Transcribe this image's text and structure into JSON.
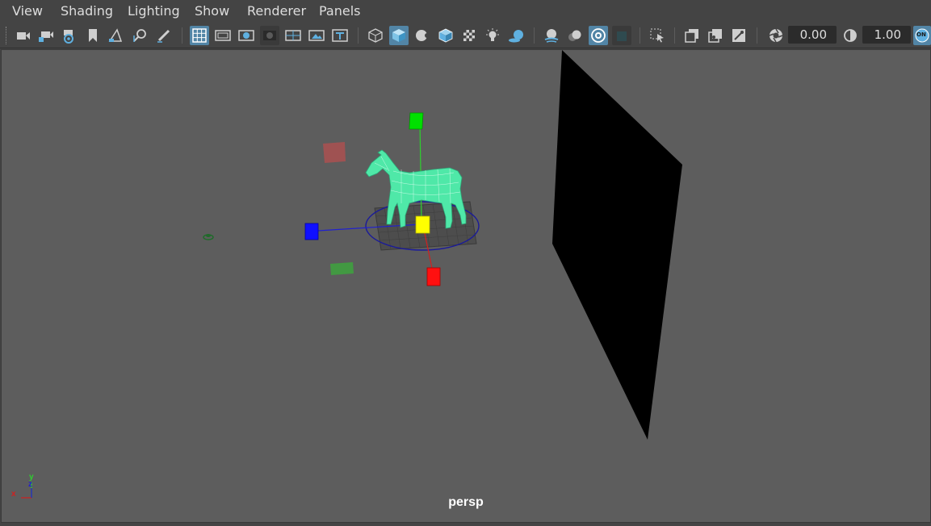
{
  "menubar": {
    "items": [
      {
        "label": "View"
      },
      {
        "label": "Shading"
      },
      {
        "label": "Lighting"
      },
      {
        "label": "Show"
      },
      {
        "label": "Renderer"
      },
      {
        "label": "Panels"
      }
    ]
  },
  "toolbar": {
    "exposure_value": "0.00",
    "gamma_value": "1.00",
    "on_label": "ON",
    "icons": [
      "select-camera-icon",
      "lock-camera-icon",
      "camera-attributes-icon",
      "bookmark-icon",
      "image-plane-icon",
      "2d-pan-zoom-icon",
      "grease-pencil-icon",
      "grid-icon",
      "film-gate-icon",
      "resolution-gate-icon",
      "gate-mask-icon",
      "field-chart-icon",
      "safe-action-icon",
      "safe-title-icon",
      "wireframe-icon",
      "smooth-shade-icon",
      "default-material-icon",
      "wireframe-on-shaded-icon",
      "textured-icon",
      "use-all-lights-icon",
      "shadows-icon",
      "screen-space-ao-icon",
      "motion-blur-icon",
      "anti-aliasing-icon",
      "depth-of-field-icon",
      "isolate-select-icon",
      "xray-icon",
      "xray-joints-icon",
      "xray-components-icon",
      "exposure-icon",
      "gamma-icon"
    ]
  },
  "viewport": {
    "camera_label": "persp",
    "axis_x": "x",
    "axis_y": "y",
    "axis_z": "z",
    "background_color": "#5d5d5d",
    "model_color": "#4fe8a8",
    "plane_color": "#000000"
  }
}
